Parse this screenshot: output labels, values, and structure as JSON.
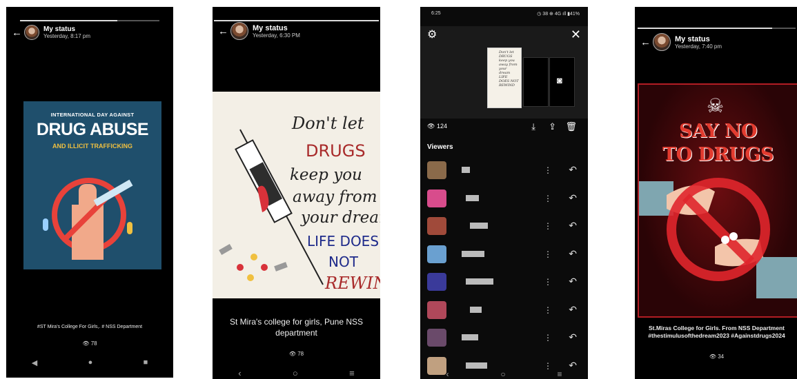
{
  "status1": {
    "title": "My status",
    "time": "Yesterday, 8:17 pm",
    "poster": {
      "line1": "INTERNATIONAL DAY AGAINST",
      "line2": "DRUG ABUSE",
      "line3": "AND ILLICIT TRAFFICKING"
    },
    "caption": "#ST Mira's College For Girls,. # NSS Department",
    "views": "78"
  },
  "status2": {
    "title": "My status",
    "time": "Yesterday, 6:30 PM",
    "poster": {
      "l1": "Don't let",
      "l2": "DRUGS",
      "l3": "keep you",
      "l4": "away from",
      "l5": "your dream",
      "l6": "LIFE DOES",
      "l7": "NOT",
      "l8": "REWIND"
    },
    "caption": "St Mira's college for girls, Pune    NSS department",
    "views": "78"
  },
  "status3": {
    "clock": "6:25",
    "signal": "◷ 38 ⊕ 4G ıll ▮41%",
    "views_count": "124",
    "viewers_label": "Viewers",
    "thumb_text": "Don't let DRUGS keep you away from your dream LIFE DOES NOT REWIND"
  },
  "status4": {
    "title": "My status",
    "time": "Yesterday, 7:40 pm",
    "poster": {
      "l1": "SAY NO",
      "l2": "TO DRUGS"
    },
    "caption": "St.Miras College for Girls. From NSS Department #thestimulusofthedream2023 #Againstdrugs2024",
    "views": "34"
  },
  "colors": {
    "accent_red": "#e23b2f",
    "poster_blue": "#1f4f6c",
    "poster_yellow": "#f0c040",
    "dark_red": "#6a0d10"
  },
  "icons": {
    "eye": "eye-icon",
    "back": "arrow-left-icon",
    "download": "download-icon",
    "share": "share-icon",
    "delete": "trash-icon",
    "reply": "reply-icon",
    "camera": "camera-icon",
    "settings": "gear-icon",
    "close": "close-icon"
  }
}
